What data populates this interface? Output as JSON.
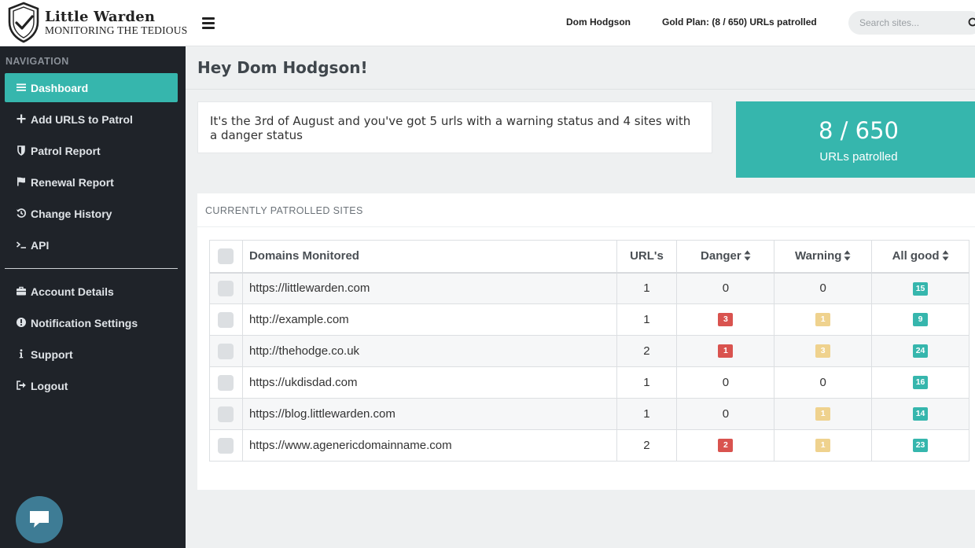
{
  "brand": {
    "name": "Little Warden",
    "tagline": "MONITORING THE TEDIOUS"
  },
  "header": {
    "user_name": "Dom Hodgson",
    "plan_info": "Gold Plan: (8 / 650) URLs patrolled",
    "search_placeholder": "Search sites..."
  },
  "sidebar": {
    "heading": "NAVIGATION",
    "items": [
      {
        "label": "Dashboard",
        "icon": "bars-icon",
        "active": true
      },
      {
        "label": "Add URLS to Patrol",
        "icon": "plus-icon"
      },
      {
        "label": "Patrol Report",
        "icon": "shield-icon"
      },
      {
        "label": "Renewal Report",
        "icon": "flag-icon"
      },
      {
        "label": "Change History",
        "icon": "history-icon"
      },
      {
        "label": "API",
        "icon": "terminal-icon"
      },
      {
        "label": "Account Details",
        "icon": "briefcase-icon"
      },
      {
        "label": "Notification Settings",
        "icon": "exclamation-circle-icon"
      },
      {
        "label": "Support",
        "icon": "info-icon"
      },
      {
        "label": "Logout",
        "icon": "sign-out-icon"
      }
    ]
  },
  "main": {
    "greeting": "Hey Dom Hodgson!",
    "summary": "It's the 3rd of August and you've got 5 urls with a warning status and 4 sites with a danger status",
    "stat": {
      "value": "8 / 650",
      "label": "URLs patrolled"
    },
    "panel_heading": "CURRENTLY PATROLLED SITES",
    "table": {
      "headers": {
        "domain": "Domains Monitored",
        "urls": "URL's",
        "danger": "Danger",
        "warning": "Warning",
        "good": "All good"
      },
      "rows": [
        {
          "domain": "https://littlewarden.com",
          "urls": "1",
          "danger": "0",
          "warning": "0",
          "good": "15"
        },
        {
          "domain": "http://example.com",
          "urls": "1",
          "danger": "3",
          "warning": "1",
          "good": "9"
        },
        {
          "domain": "http://thehodge.co.uk",
          "urls": "2",
          "danger": "1",
          "warning": "3",
          "good": "24"
        },
        {
          "domain": "https://ukdisdad.com",
          "urls": "1",
          "danger": "0",
          "warning": "0",
          "good": "16"
        },
        {
          "domain": "https://blog.littlewarden.com",
          "urls": "1",
          "danger": "0",
          "warning": "1",
          "good": "14"
        },
        {
          "domain": "https://www.agenericdomainname.com",
          "urls": "2",
          "danger": "2",
          "warning": "1",
          "good": "23"
        }
      ]
    }
  },
  "colors": {
    "accent": "#36b6ad",
    "danger": "#d9534f",
    "warning": "#efd28e",
    "sidebar_bg": "#1f2329",
    "chat_button": "#3e7c95"
  }
}
